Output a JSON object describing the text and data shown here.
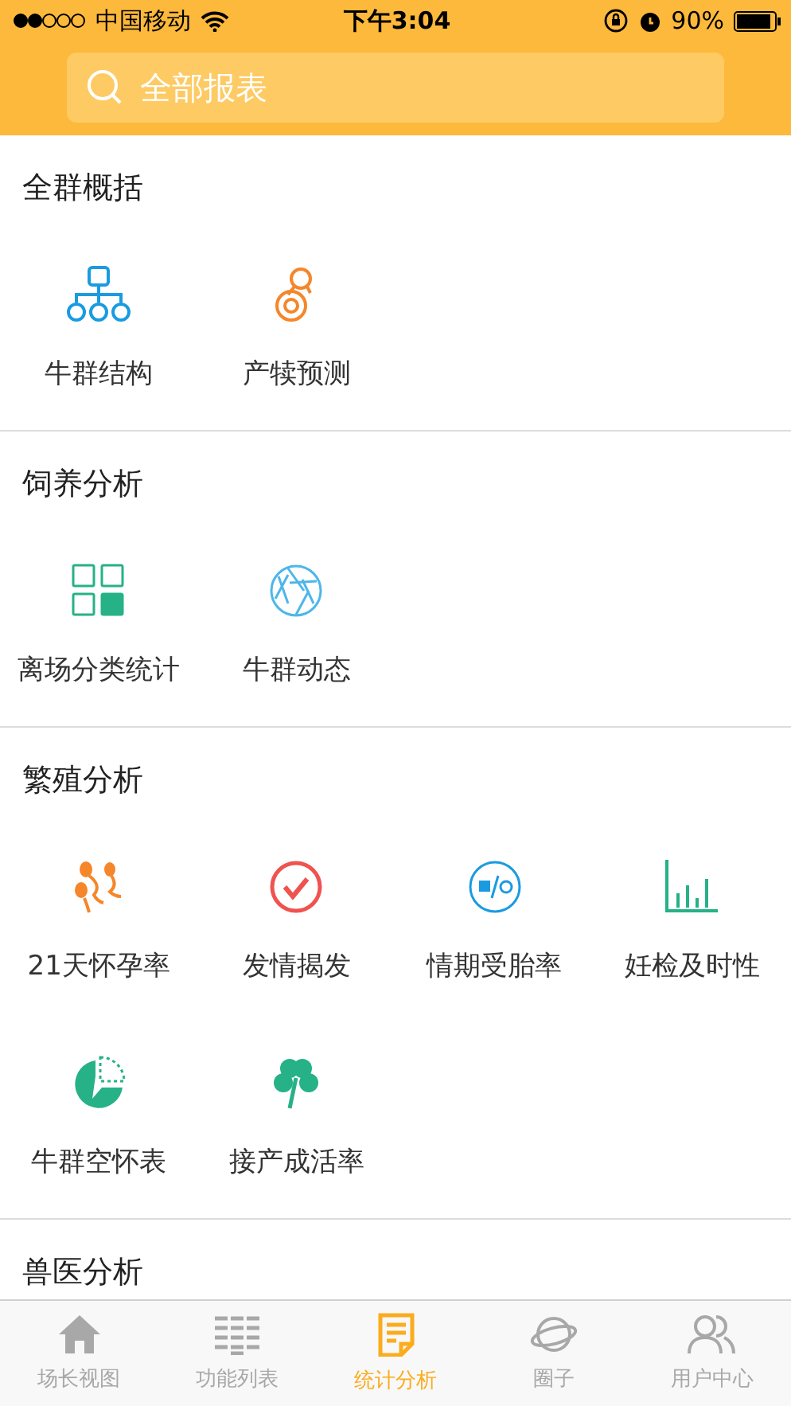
{
  "status_bar": {
    "carrier": "中国移动",
    "time": "下午3:04",
    "battery": "90%"
  },
  "search": {
    "placeholder": "全部报表"
  },
  "sections": [
    {
      "title": "全群概括",
      "items": [
        {
          "label": "牛群结构"
        },
        {
          "label": "产犊预测"
        }
      ]
    },
    {
      "title": "饲养分析",
      "items": [
        {
          "label": "离场分类统计"
        },
        {
          "label": "牛群动态"
        }
      ]
    },
    {
      "title": "繁殖分析",
      "items": [
        {
          "label": "21天怀孕率"
        },
        {
          "label": "发情揭发"
        },
        {
          "label": "情期受胎率"
        },
        {
          "label": "妊检及时性"
        },
        {
          "label": "牛群空怀表"
        },
        {
          "label": "接产成活率"
        }
      ]
    },
    {
      "title": "兽医分析"
    }
  ],
  "tabs": [
    {
      "label": "场长视图",
      "selected": false
    },
    {
      "label": "功能列表",
      "selected": false
    },
    {
      "label": "统计分析",
      "selected": true
    },
    {
      "label": "圈子",
      "selected": false
    },
    {
      "label": "用户中心",
      "selected": false
    }
  ]
}
